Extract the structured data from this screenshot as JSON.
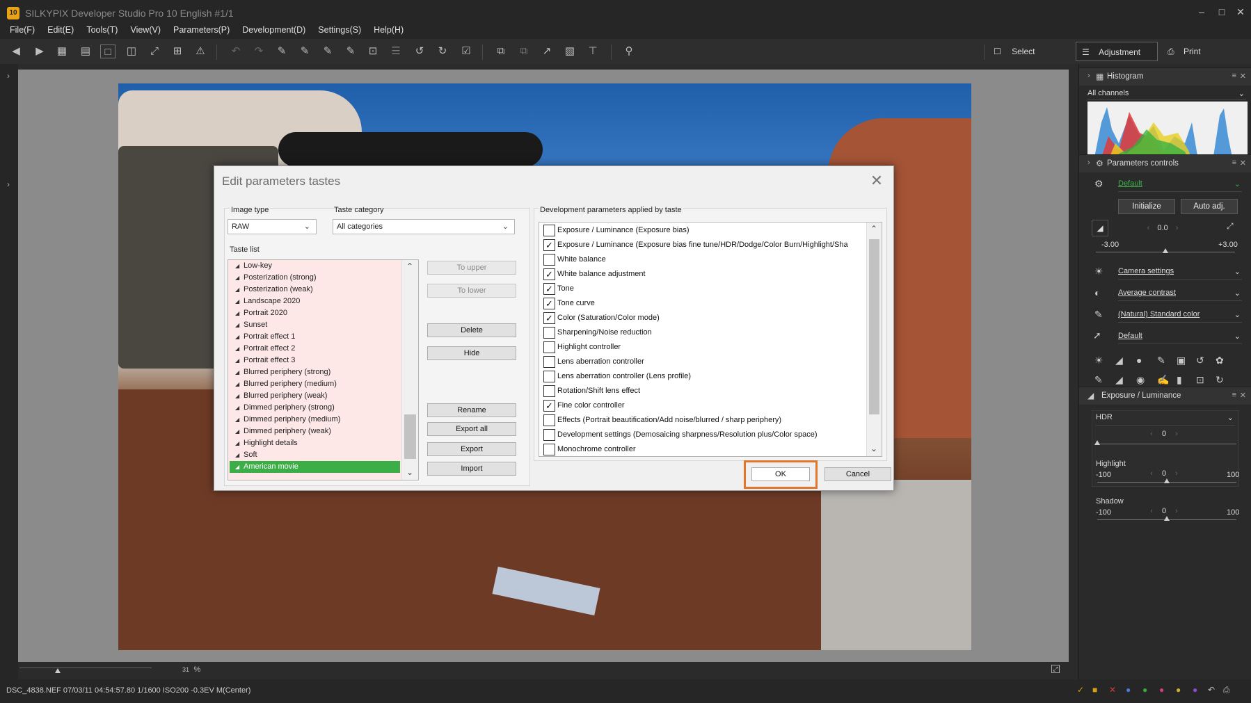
{
  "app": {
    "logo_text": "10",
    "title": "SILKYPIX Developer Studio Pro 10 English   #1/1",
    "minimize": "–",
    "maximize": "□",
    "close": "✕"
  },
  "menu": [
    "File(F)",
    "Edit(E)",
    "Tools(T)",
    "View(V)",
    "Parameters(P)",
    "Development(D)",
    "Settings(S)",
    "Help(H)"
  ],
  "toolbar": {
    "icons": [
      "prev-icon",
      "next-icon",
      "grid-view-icon",
      "filmstrip-view-icon",
      "single-view-icon",
      "compare-view-icon",
      "fullscreen-icon",
      "split-view-icon",
      "warning-icon",
      "undo-icon",
      "redo-icon",
      "eyedropper-gray-icon",
      "eyedropper-white-icon",
      "eyedropper-skin-icon",
      "eyedropper-color-icon",
      "crop-icon",
      "layers-icon",
      "rotate-left-icon",
      "rotate-right-icon",
      "check-icon",
      "copy-params-icon",
      "paste-params-icon",
      "export-icon",
      "develop-icon",
      "stamp-icon",
      "zoom-icon"
    ],
    "modes": {
      "select": "Select",
      "adjustment": "Adjustment",
      "print": "Print"
    }
  },
  "zoom": {
    "value": "31",
    "unit": "%"
  },
  "status": {
    "text": "DSC_4838.NEF 07/03/11 04:54:57.80 1/1600 ISO200 -0.3EV M(Center)"
  },
  "right_panel": {
    "histogram": {
      "title": "Histogram",
      "channel": "All channels"
    },
    "params_controls": {
      "title": "Parameters controls",
      "taste": "Default",
      "initialize": "Initialize",
      "auto_adj": "Auto adj.",
      "exposure_value": "0.0",
      "exposure_min": "-3.00",
      "exposure_max": "+3.00",
      "white_balance": "Camera settings",
      "tone": "Average contrast",
      "color": "(Natural) Standard color",
      "tone_curve": "Default"
    },
    "exposure_panel": {
      "title": "Exposure / Luminance",
      "mode": "HDR",
      "hdr_value": "0",
      "highlight_label": "Highlight",
      "highlight_min": "-100",
      "highlight_value": "0",
      "highlight_max": "100",
      "shadow_label": "Shadow",
      "shadow_min": "-100",
      "shadow_value": "0",
      "shadow_max": "100"
    }
  },
  "dialog": {
    "title": "Edit parameters tastes",
    "image_type_label": "Image type",
    "image_type_value": "RAW",
    "taste_category_label": "Taste category",
    "taste_category_value": "All categories",
    "taste_list_label": "Taste list",
    "taste_list": [
      "Low-key",
      "Posterization (strong)",
      "Posterization (weak)",
      "Landscape 2020",
      "Portrait 2020",
      "Sunset",
      "Portrait effect 1",
      "Portrait effect 2",
      "Portrait effect 3",
      "Blurred periphery (strong)",
      "Blurred periphery (medium)",
      "Blurred periphery (weak)",
      "Dimmed periphery (strong)",
      "Dimmed periphery (medium)",
      "Dimmed periphery (weak)",
      "Highlight details",
      "Soft",
      "American movie"
    ],
    "selected_taste": "American movie",
    "buttons": {
      "to_upper": "To upper",
      "to_lower": "To lower",
      "delete": "Delete",
      "hide": "Hide",
      "rename": "Rename",
      "export_all": "Export all",
      "export": "Export",
      "import": "Import",
      "ok": "OK",
      "cancel": "Cancel"
    },
    "dev_params_label": "Development parameters applied by taste",
    "dev_params": [
      {
        "label": "Exposure / Luminance (Exposure bias)",
        "checked": false
      },
      {
        "label": "Exposure / Luminance (Exposure bias fine tune/HDR/Dodge/Color Burn/Highlight/Sha",
        "checked": true
      },
      {
        "label": "White balance",
        "checked": false
      },
      {
        "label": "White balance adjustment",
        "checked": true
      },
      {
        "label": "Tone",
        "checked": true
      },
      {
        "label": "Tone curve",
        "checked": true
      },
      {
        "label": "Color (Saturation/Color mode)",
        "checked": true
      },
      {
        "label": "Sharpening/Noise reduction",
        "checked": false
      },
      {
        "label": "Highlight controller",
        "checked": false
      },
      {
        "label": "Lens aberration controller",
        "checked": false
      },
      {
        "label": "Lens aberration controller (Lens profile)",
        "checked": false
      },
      {
        "label": "Rotation/Shift lens effect",
        "checked": false
      },
      {
        "label": "Fine color controller",
        "checked": true
      },
      {
        "label": "Effects (Portrait beautification/Add noise/blurred / sharp periphery)",
        "checked": false
      },
      {
        "label": "Development settings (Demosaicing sharpness/Resolution plus/Color space)",
        "checked": false
      },
      {
        "label": "Monochrome controller",
        "checked": false
      }
    ]
  }
}
